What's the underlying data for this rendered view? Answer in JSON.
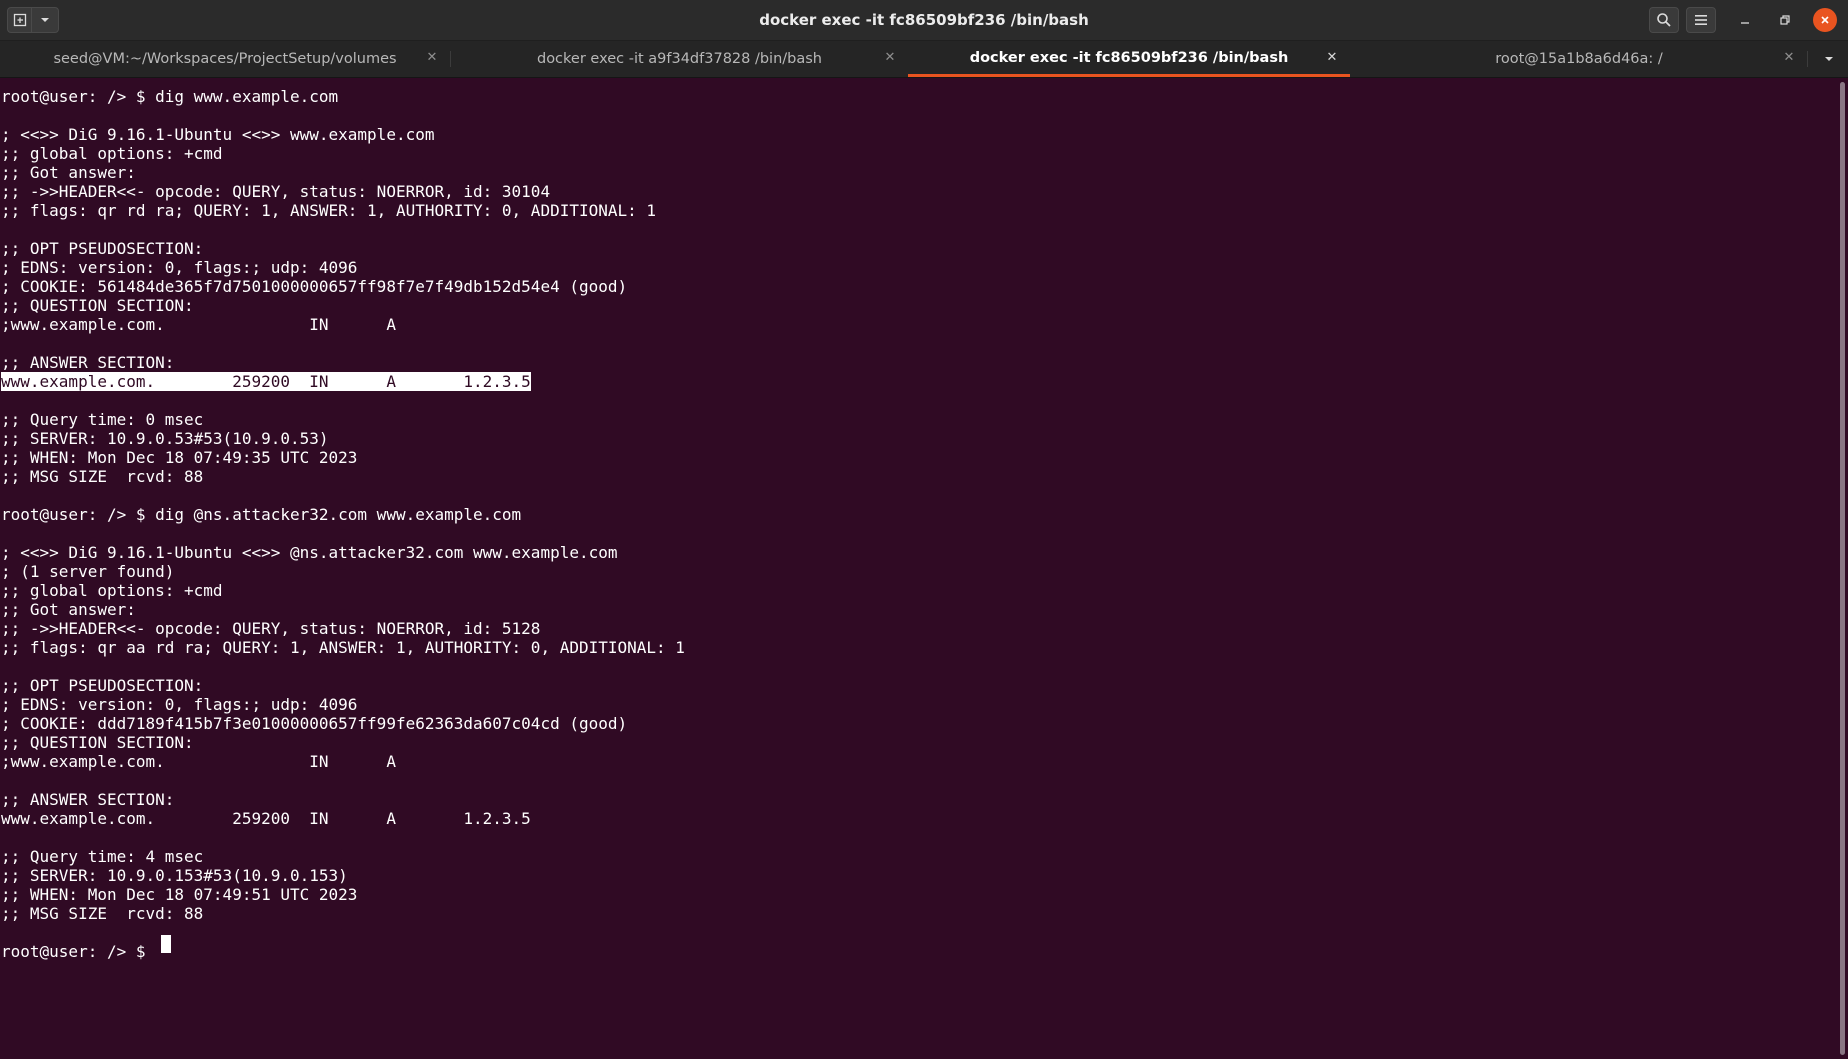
{
  "window": {
    "title": "docker exec -it fc86509bf236 /bin/bash",
    "close_color": "#e95420",
    "accent": "#e95420",
    "background": "#300a24"
  },
  "icons": {
    "new_tab": "new-tab-icon",
    "tab_menu": "chevron-down-icon",
    "search": "search-icon",
    "menu": "hamburger-menu-icon",
    "minimize": "minimize-icon",
    "restore": "restore-icon",
    "close": "close-icon",
    "tabs_overflow": "chevron-down-icon"
  },
  "tabs": [
    {
      "label": "seed@VM:~/Workspaces/ProjectSetup/volumes",
      "active": false
    },
    {
      "label": "docker exec -it a9f34df37828 /bin/bash",
      "active": false
    },
    {
      "label": "docker exec -it fc86509bf236 /bin/bash",
      "active": true
    },
    {
      "label": "root@15a1b8a6d46a: /",
      "active": false
    }
  ],
  "terminal": {
    "lines": [
      "root@user: /> $ dig www.example.com",
      "",
      "; <<>> DiG 9.16.1-Ubuntu <<>> www.example.com",
      ";; global options: +cmd",
      ";; Got answer:",
      ";; ->>HEADER<<- opcode: QUERY, status: NOERROR, id: 30104",
      ";; flags: qr rd ra; QUERY: 1, ANSWER: 1, AUTHORITY: 0, ADDITIONAL: 1",
      "",
      ";; OPT PSEUDOSECTION:",
      "; EDNS: version: 0, flags:; udp: 4096",
      "; COOKIE: 561484de365f7d7501000000657ff98f7e7f49db152d54e4 (good)",
      ";; QUESTION SECTION:",
      ";www.example.com.               IN      A",
      "",
      ";; ANSWER SECTION:",
      "www.example.com.        259200  IN      A       1.2.3.5",
      "",
      ";; Query time: 0 msec",
      ";; SERVER: 10.9.0.53#53(10.9.0.53)",
      ";; WHEN: Mon Dec 18 07:49:35 UTC 2023",
      ";; MSG SIZE  rcvd: 88",
      "",
      "root@user: /> $ dig @ns.attacker32.com www.example.com",
      "",
      "; <<>> DiG 9.16.1-Ubuntu <<>> @ns.attacker32.com www.example.com",
      "; (1 server found)",
      ";; global options: +cmd",
      ";; Got answer:",
      ";; ->>HEADER<<- opcode: QUERY, status: NOERROR, id: 5128",
      ";; flags: qr aa rd ra; QUERY: 1, ANSWER: 1, AUTHORITY: 0, ADDITIONAL: 1",
      "",
      ";; OPT PSEUDOSECTION:",
      "; EDNS: version: 0, flags:; udp: 4096",
      "; COOKIE: ddd7189f415b7f3e01000000657ff99fe62363da607c04cd (good)",
      ";; QUESTION SECTION:",
      ";www.example.com.               IN      A",
      "",
      ";; ANSWER SECTION:",
      "www.example.com.        259200  IN      A       1.2.3.5",
      "",
      ";; Query time: 4 msec",
      ";; SERVER: 10.9.0.153#53(10.9.0.153)",
      ";; WHEN: Mon Dec 18 07:49:51 UTC 2023",
      ";; MSG SIZE  rcvd: 88",
      "",
      "root@user: /> $ "
    ],
    "selected_line": 15
  }
}
